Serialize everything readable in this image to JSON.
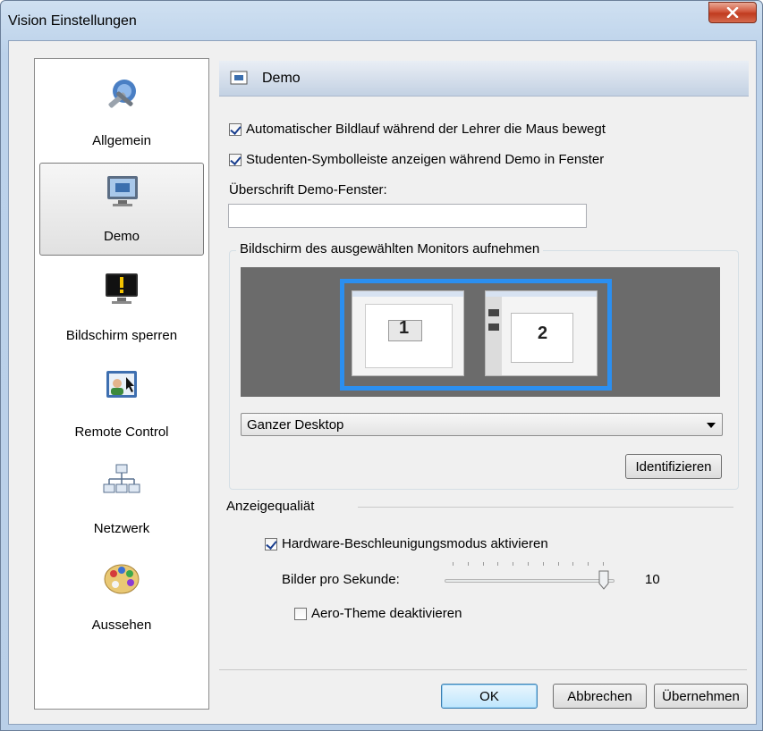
{
  "window": {
    "title": "Vision Einstellungen"
  },
  "sidebar": {
    "items": [
      {
        "label": "Allgemein",
        "icon": "tools-icon"
      },
      {
        "label": "Demo",
        "icon": "demo-screen-icon",
        "selected": true
      },
      {
        "label": "Bildschirm sperren",
        "icon": "lock-screen-icon"
      },
      {
        "label": "Remote Control",
        "icon": "remote-control-icon"
      },
      {
        "label": "Netzwerk",
        "icon": "network-icon"
      },
      {
        "label": "Aussehen",
        "icon": "palette-icon"
      }
    ]
  },
  "panel": {
    "title": "Demo",
    "auto_scroll_label": "Automatischer Bildlauf während der Lehrer die Maus bewegt",
    "auto_scroll_checked": true,
    "student_toolbar_label": "Studenten-Symbolleiste anzeigen während Demo in Fenster",
    "student_toolbar_checked": true,
    "window_title_label": "Überschrift Demo-Fenster:",
    "window_title_value": "",
    "monitor_group_label": "Bildschirm des ausgewählten Monitors aufnehmen",
    "monitors": [
      "1",
      "2"
    ],
    "desktop_dropdown_value": "Ganzer Desktop",
    "identify_button": "Identifizieren",
    "quality_label": "Anzeigequaliät",
    "hw_accel_label": "Hardware-Beschleunigungsmodus aktivieren",
    "hw_accel_checked": true,
    "fps_label": "Bilder pro Sekunde:",
    "fps_value": "10",
    "fps_slider_fraction": 1.0,
    "aero_label": "Aero-Theme deaktivieren",
    "aero_checked": false
  },
  "buttons": {
    "ok": "OK",
    "cancel": "Abbrechen",
    "apply": "Übernehmen"
  },
  "colors": {
    "selection_frame": "#2b8ff0",
    "close_button": "#c9452a",
    "header_gradient_end": "#c3d1e3"
  }
}
